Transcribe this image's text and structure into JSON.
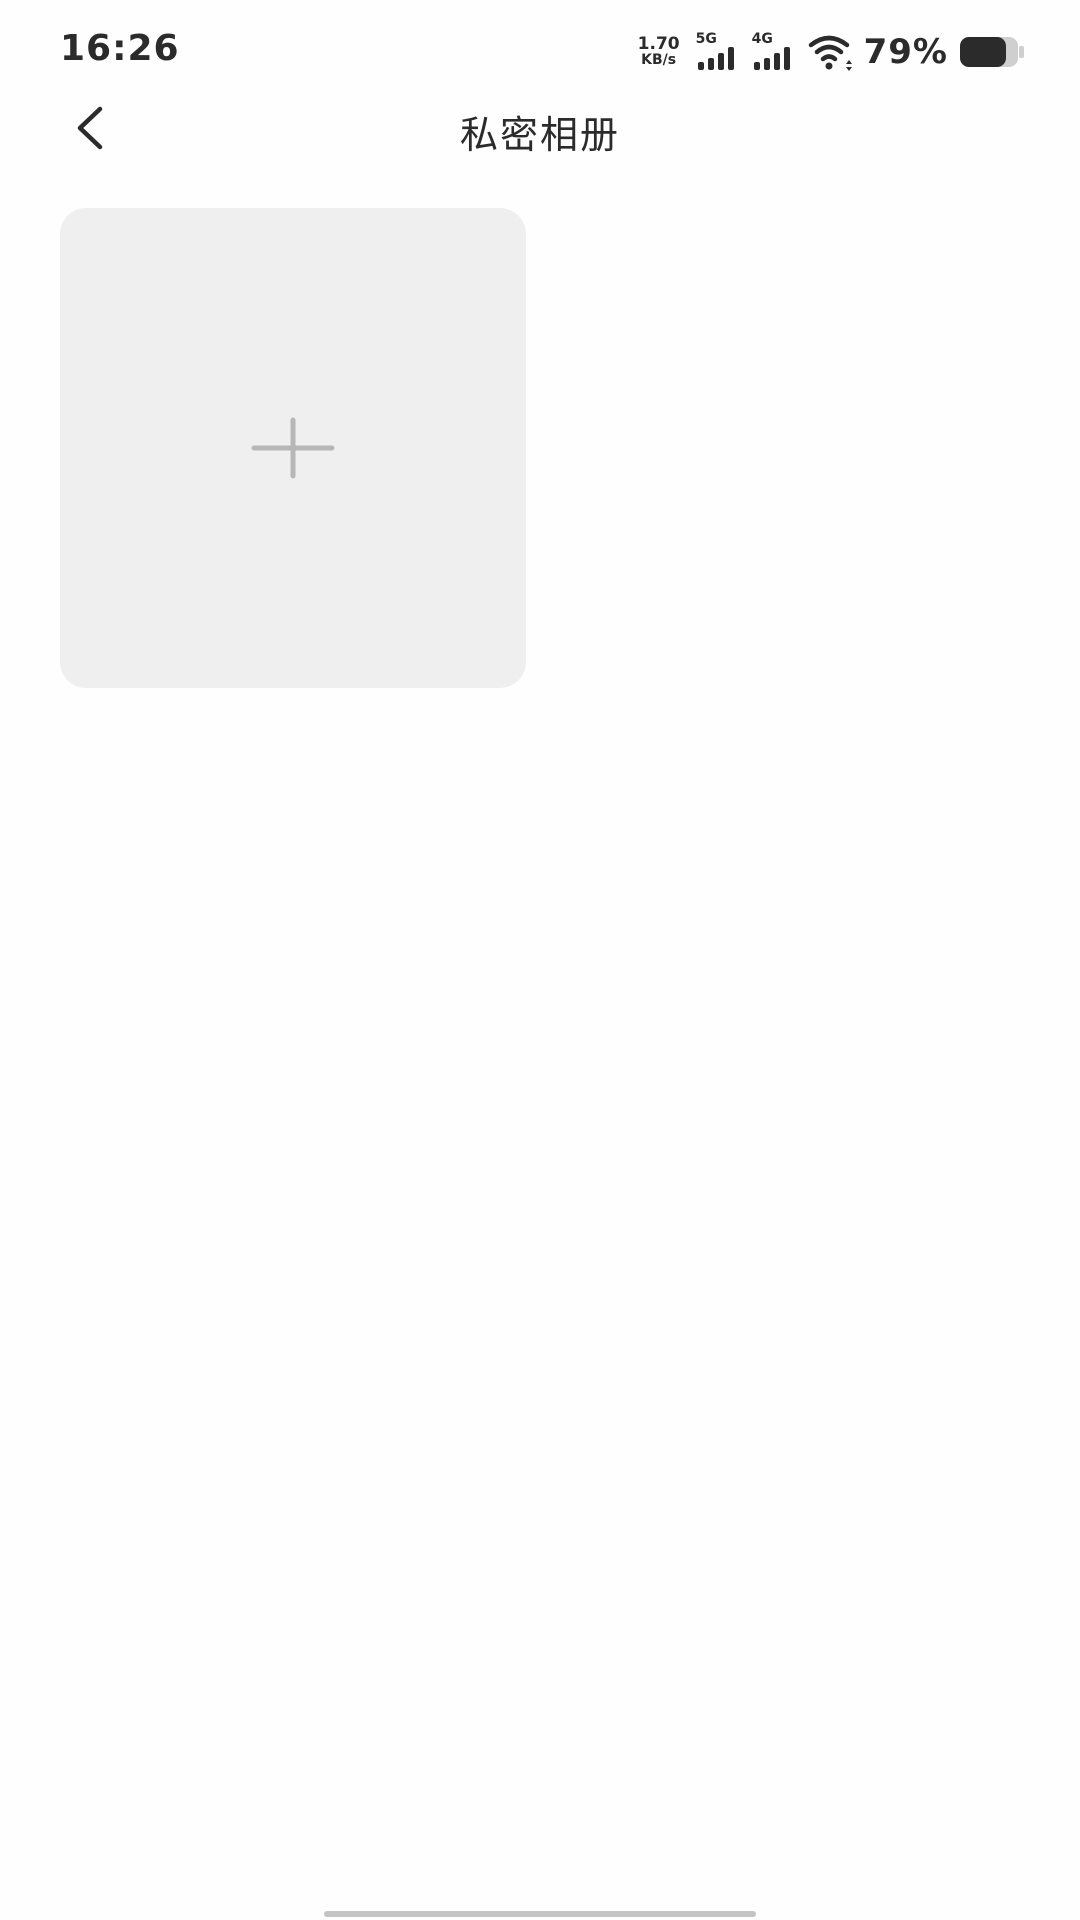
{
  "status_bar": {
    "time": "16:26",
    "net_speed_value": "1.70",
    "net_speed_unit": "KB/s",
    "signal_1_label": "5G",
    "signal_2_label": "4G",
    "battery_percent": "79%",
    "battery_level": 0.79,
    "icons": {
      "signal_1": "cellular-signal-icon",
      "signal_2": "cellular-signal-icon",
      "wifi": "wifi-icon",
      "battery": "battery-icon"
    }
  },
  "header": {
    "title": "私密相册",
    "back_icon": "chevron-left-icon"
  },
  "album_grid": {
    "add_tile_icon": "plus-icon"
  },
  "colors": {
    "background": "#FEFEFE",
    "tile_background": "#EFEFEF",
    "plus_stroke": "#B7B7B7",
    "text": "#2B2B2B",
    "home_indicator": "#C4C4C4"
  }
}
